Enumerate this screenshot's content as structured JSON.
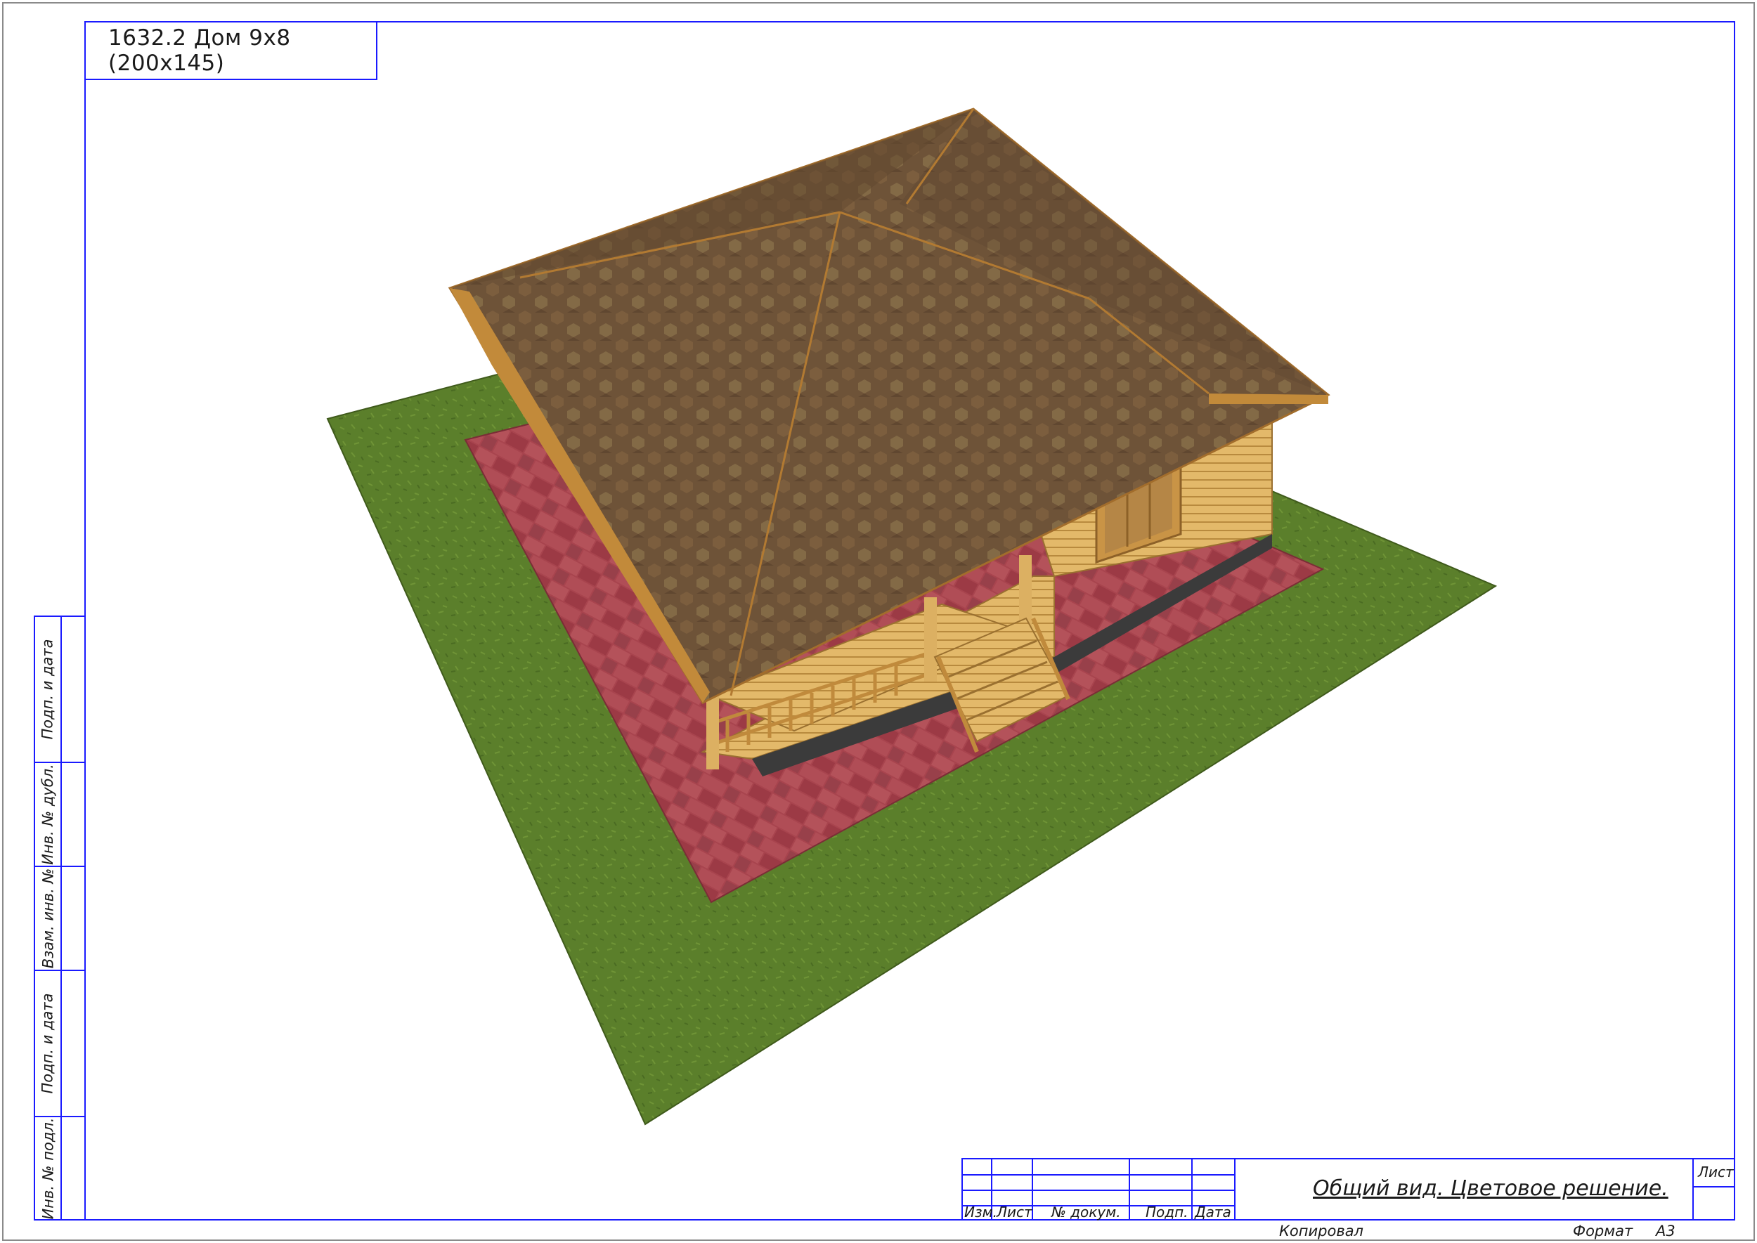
{
  "title": "1632.2 Дом 9х8 (200х145)",
  "side_strip": {
    "cells": [
      "Подп. и дата",
      "Инв. № дубл.",
      "Взам. инв. №",
      "Подп. и дата",
      "Инв. № подл."
    ]
  },
  "stamp": {
    "columns": [
      "Изм.",
      "Лист",
      "№ докум.",
      "Подп.",
      "Дата"
    ],
    "document_title": "Общий вид. Цветовое решение.",
    "sheet_label": "Лист"
  },
  "footer": {
    "copied": "Копировал",
    "format_label": "Формат",
    "format_value": "А3"
  },
  "colors": {
    "frame": "#1a1aff",
    "grass": "#5a7f2a",
    "paving": "#a4404a",
    "roof": "#6e5238",
    "timber": "#e0b668"
  }
}
